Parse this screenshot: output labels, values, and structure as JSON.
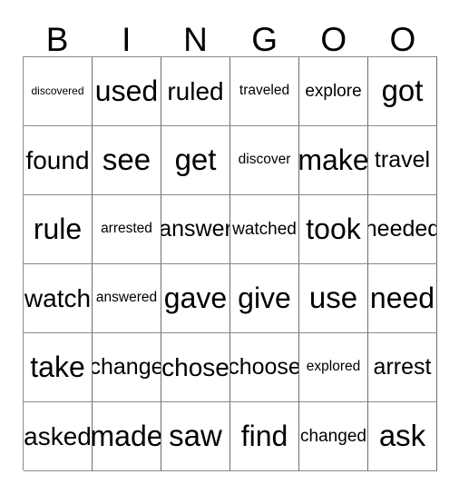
{
  "card": {
    "title_letters": [
      "B",
      "I",
      "N",
      "G",
      "O",
      "O"
    ],
    "ink_color": "#000000",
    "grid_line_color": "#8a8a8a",
    "background_color": "#ffffff",
    "columns": 6,
    "rows": 6,
    "grid": [
      [
        "discovered",
        "used",
        "ruled",
        "traveled",
        "explore",
        "got"
      ],
      [
        "found",
        "see",
        "get",
        "discover",
        "make",
        "travel"
      ],
      [
        "rule",
        "arrested",
        "answer",
        "watched",
        "took",
        "needed"
      ],
      [
        "watch",
        "answered",
        "gave",
        "give",
        "use",
        "need"
      ],
      [
        "take",
        "change",
        "chose",
        "choose",
        "explored",
        "arrest"
      ],
      [
        "asked",
        "made",
        "saw",
        "find",
        "changed",
        "ask"
      ]
    ]
  }
}
